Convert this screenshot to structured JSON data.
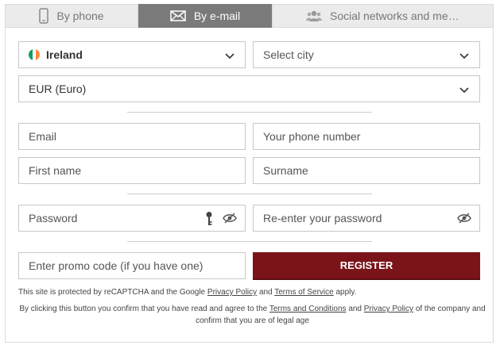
{
  "tabs": [
    {
      "label": "By phone",
      "icon": "phone-icon"
    },
    {
      "label": "By e-mail",
      "icon": "envelope-icon",
      "active": true
    },
    {
      "label": "Social networks and messengers",
      "icon": "users-icon"
    }
  ],
  "form": {
    "country": {
      "value": "Ireland",
      "icon": "ireland-flag-icon"
    },
    "city": {
      "placeholder": "Select city"
    },
    "currency": {
      "value": "EUR (Euro)"
    },
    "email": {
      "placeholder": "Email"
    },
    "phone": {
      "placeholder": "Your phone number"
    },
    "first_name": {
      "placeholder": "First name"
    },
    "surname": {
      "placeholder": "Surname"
    },
    "password": {
      "placeholder": "Password"
    },
    "reenter_password": {
      "placeholder": "Re-enter your password"
    },
    "promo": {
      "placeholder": "Enter promo code (if you have one)"
    },
    "register_label": "REGISTER"
  },
  "notes": {
    "recaptcha_pre": "This site is protected by reCAPTCHA and the Google",
    "recaptcha_privacy": "Privacy Policy",
    "recaptcha_and": "and",
    "recaptcha_terms": "Terms of Service",
    "recaptcha_post": "apply.",
    "consent_pre": "By clicking this button you confirm that you have read and agree to the",
    "consent_terms": "Terms and Conditions",
    "consent_and": "and",
    "consent_privacy": "Privacy Policy",
    "consent_post": "of the company and confirm that you are of legal age"
  },
  "colors": {
    "register_bg": "#7b1419",
    "active_tab_bg": "#7a7a7a",
    "inactive_tab_bg": "#ebebeb"
  }
}
